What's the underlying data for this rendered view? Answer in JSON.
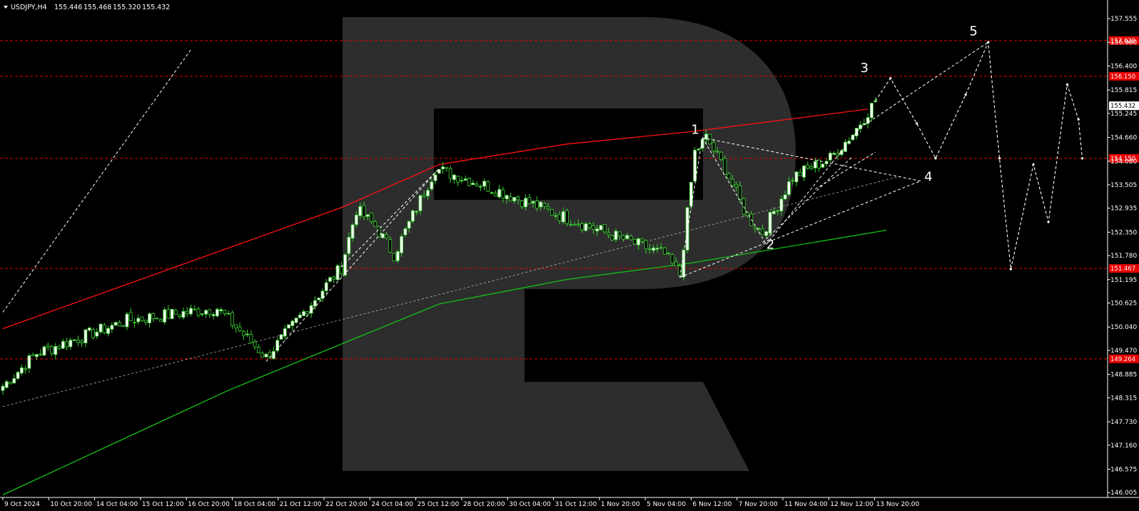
{
  "header": {
    "symbol": "USDJPY,H4",
    "open": "155.446",
    "high": "155.468",
    "low": "155.320",
    "close": "155.432"
  },
  "chart_data": {
    "type": "candlestick",
    "ylim": [
      145.9,
      158.1
    ],
    "y_ticks": [
      "157.555",
      "156.980",
      "156.400",
      "155.815",
      "155.245",
      "154.660",
      "154.080",
      "153.505",
      "152.935",
      "152.350",
      "151.780",
      "151.195",
      "150.625",
      "150.040",
      "149.470",
      "148.885",
      "148.315",
      "147.730",
      "147.160",
      "146.575",
      "146.005"
    ],
    "x_ticks": [
      "9 Oct 2024",
      "10 Oct 20:00",
      "14 Oct 04:00",
      "15 Oct 12:00",
      "16 Oct 20:00",
      "18 Oct 04:00",
      "21 Oct 12:00",
      "22 Oct 20:00",
      "24 Oct 04:00",
      "25 Oct 12:00",
      "28 Oct 20:00",
      "30 Oct 04:00",
      "31 Oct 12:00",
      "1 Nov 20:00",
      "5 Nov 04:00",
      "6 Nov 12:00",
      "7 Nov 20:00",
      "11 Nov 04:00",
      "12 Nov 12:00",
      "13 Nov 20:00"
    ],
    "levels": [
      {
        "value": 157.02,
        "label": "157.020"
      },
      {
        "value": 156.15,
        "label": "156.150"
      },
      {
        "value": 154.15,
        "label": "154.150"
      },
      {
        "value": 151.467,
        "label": "151.467"
      },
      {
        "value": 149.264,
        "label": "149.264"
      }
    ],
    "current_price": {
      "value": 155.432,
      "label": "155.432"
    },
    "wave_labels": [
      {
        "label": "1",
        "bar": 183,
        "price": 154.75
      },
      {
        "label": "2",
        "bar": 203,
        "price": 151.95
      },
      {
        "label": "3",
        "bar": 228,
        "price": 156.25
      },
      {
        "label": "4",
        "bar": 245,
        "price": 153.6
      },
      {
        "label": "5",
        "bar": 257,
        "price": 157.15
      }
    ],
    "ma_red": [
      [
        0,
        150.0
      ],
      [
        90,
        152.95
      ],
      [
        116,
        154.0
      ],
      [
        150,
        154.5
      ],
      [
        183,
        154.8
      ],
      [
        230,
        155.35
      ]
    ],
    "ma_green": [
      [
        0,
        145.95
      ],
      [
        60,
        148.5
      ],
      [
        116,
        150.6
      ],
      [
        150,
        151.2
      ],
      [
        183,
        151.6
      ],
      [
        235,
        152.4
      ]
    ],
    "key_points": [
      [
        0,
        148.6
      ],
      [
        9,
        149.4
      ],
      [
        33,
        150.2
      ],
      [
        57,
        150.5
      ],
      [
        70,
        149.3
      ],
      [
        90,
        151.5
      ],
      [
        94,
        152.9
      ],
      [
        99,
        152.5
      ],
      [
        104,
        151.8
      ],
      [
        115,
        153.9
      ],
      [
        128,
        153.5
      ],
      [
        147,
        152.8
      ],
      [
        176,
        151.8
      ],
      [
        180,
        151.3
      ],
      [
        184,
        154.3
      ],
      [
        187,
        154.65
      ],
      [
        192,
        153.9
      ],
      [
        198,
        152.7
      ],
      [
        202,
        152.35
      ],
      [
        210,
        153.7
      ],
      [
        220,
        154.15
      ],
      [
        226,
        154.75
      ],
      [
        232,
        155.55
      ]
    ],
    "forecast_points": [
      [
        236,
        156.1
      ],
      [
        243,
        155.0
      ],
      [
        248,
        154.15
      ],
      [
        256,
        155.7
      ],
      [
        262,
        156.98
      ],
      [
        265,
        154.15
      ],
      [
        268,
        151.45
      ],
      [
        274,
        154.0
      ],
      [
        278,
        152.6
      ],
      [
        283,
        155.95
      ],
      [
        286,
        155.1
      ],
      [
        287,
        154.15
      ]
    ],
    "series_colors": {
      "bull": "#ffffff",
      "bear": "#000000",
      "outline": "#39d12f",
      "ma_red": "#ff1111",
      "ma_green": "#16c016",
      "level": "#e60000",
      "grid": "#b5b5b5"
    }
  }
}
